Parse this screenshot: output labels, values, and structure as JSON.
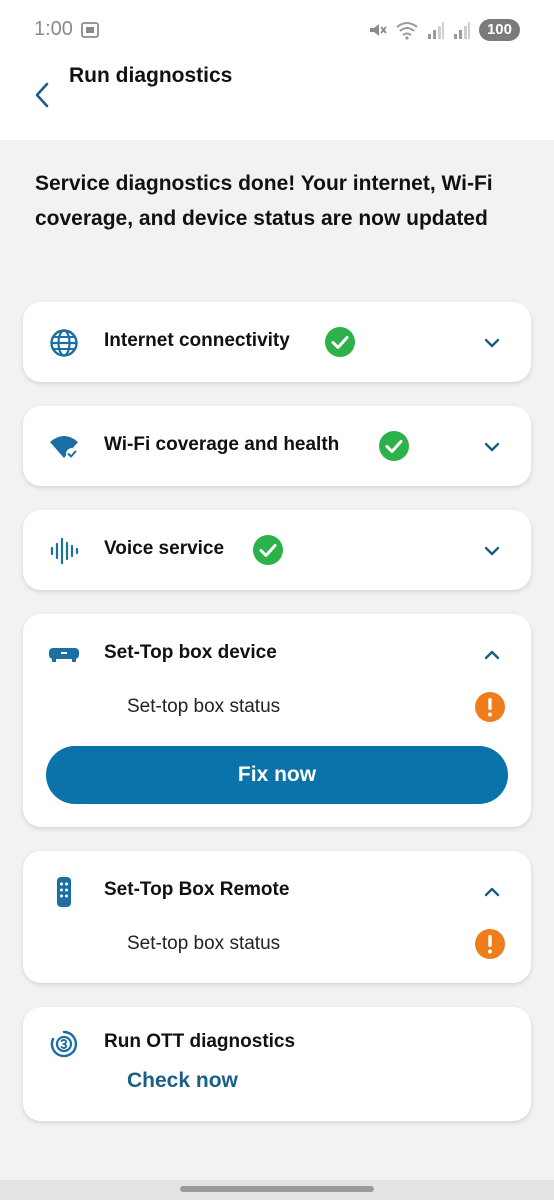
{
  "status_bar": {
    "time": "1:00",
    "battery": "100"
  },
  "header": {
    "title": "Run diagnostics"
  },
  "headline": "Service diagnostics done! Your internet, Wi-Fi coverage, and device status are now updated",
  "cards": {
    "internet": {
      "label": "Internet connectivity",
      "status": "ok"
    },
    "wifi": {
      "label": "Wi-Fi coverage and health",
      "status": "ok"
    },
    "voice": {
      "label": "Voice service",
      "status": "ok"
    },
    "settop": {
      "label": "Set-Top box device",
      "sub_label": "Set-top box status",
      "status": "warning",
      "button": "Fix now"
    },
    "remote": {
      "label": "Set-Top Box Remote",
      "sub_label": "Set-top box status",
      "status": "warning"
    },
    "ott": {
      "label": "Run OTT diagnostics",
      "link": "Check now"
    }
  },
  "colors": {
    "accent": "#0b73aa",
    "icon_blue": "#1a6fa3",
    "success": "#2db24a",
    "warning": "#f07d1c",
    "link": "#1a5f86"
  }
}
